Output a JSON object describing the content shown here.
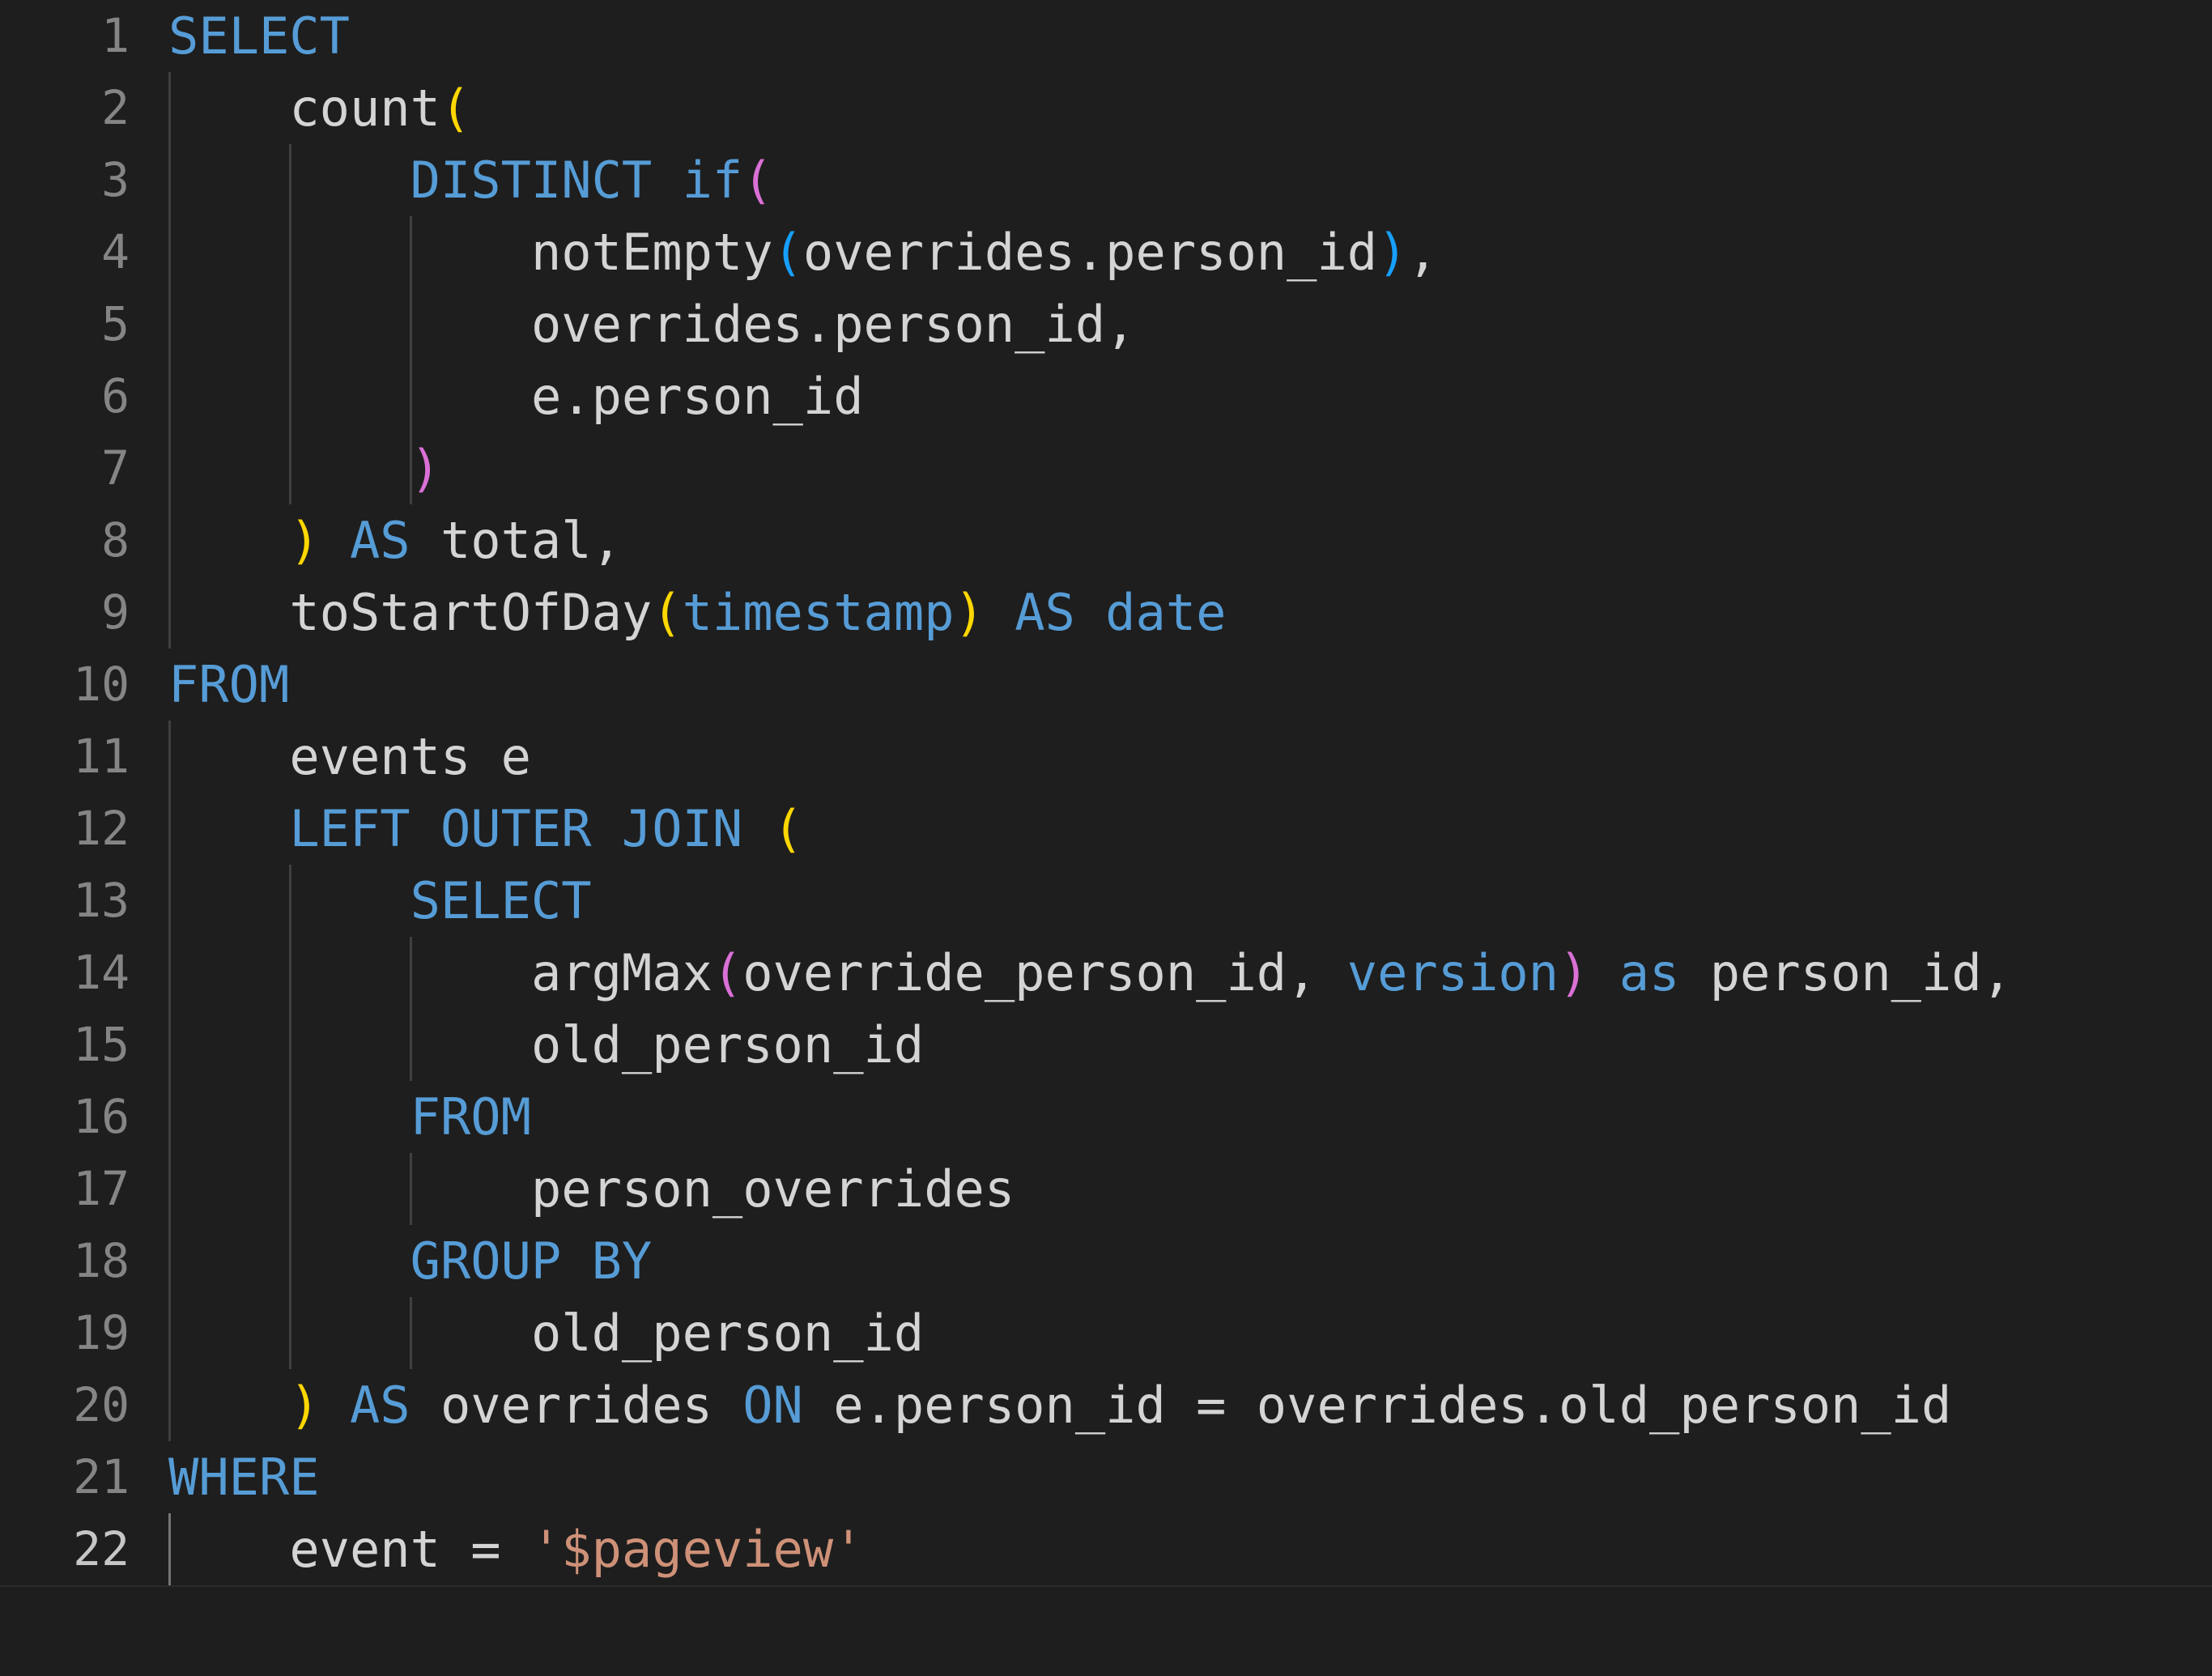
{
  "editor": {
    "language": "sql",
    "theme": "dark-plus",
    "background": "#1e1e1e",
    "active_line": 22,
    "colors": {
      "background": "#1e1e1e",
      "foreground": "#d4d4d4",
      "line_number": "#858585",
      "line_number_active": "#c6c6c6",
      "keyword": "#569cd6",
      "string": "#ce9178",
      "bracket_depth_1": "#ffd700",
      "bracket_depth_2": "#da70d6",
      "bracket_depth_3": "#179fff",
      "indent_guide": "#404040",
      "indent_guide_active": "#767676"
    },
    "lines": [
      {
        "number": "1",
        "indent": 0,
        "guides": [],
        "tokens": [
          {
            "t": "SELECT",
            "c": "kw"
          }
        ]
      },
      {
        "number": "2",
        "indent": 1,
        "guides": [
          0
        ],
        "tokens": [
          {
            "t": "    ",
            "c": "plain"
          },
          {
            "t": "count",
            "c": "plain"
          },
          {
            "t": "(",
            "c": "b1"
          }
        ]
      },
      {
        "number": "3",
        "indent": 2,
        "guides": [
          0,
          1
        ],
        "tokens": [
          {
            "t": "        ",
            "c": "plain"
          },
          {
            "t": "DISTINCT",
            "c": "kw"
          },
          {
            "t": " ",
            "c": "plain"
          },
          {
            "t": "if",
            "c": "kw"
          },
          {
            "t": "(",
            "c": "b2"
          }
        ]
      },
      {
        "number": "4",
        "indent": 3,
        "guides": [
          0,
          1,
          2
        ],
        "tokens": [
          {
            "t": "            ",
            "c": "plain"
          },
          {
            "t": "notEmpty",
            "c": "plain"
          },
          {
            "t": "(",
            "c": "b3"
          },
          {
            "t": "overrides.person_id",
            "c": "plain"
          },
          {
            "t": ")",
            "c": "b3"
          },
          {
            "t": ",",
            "c": "plain"
          }
        ]
      },
      {
        "number": "5",
        "indent": 3,
        "guides": [
          0,
          1,
          2
        ],
        "tokens": [
          {
            "t": "            ",
            "c": "plain"
          },
          {
            "t": "overrides.person_id,",
            "c": "plain"
          }
        ]
      },
      {
        "number": "6",
        "indent": 3,
        "guides": [
          0,
          1,
          2
        ],
        "tokens": [
          {
            "t": "            ",
            "c": "plain"
          },
          {
            "t": "e.person_id",
            "c": "plain"
          }
        ]
      },
      {
        "number": "7",
        "indent": 2,
        "guides": [
          0,
          1,
          2
        ],
        "tokens": [
          {
            "t": "        ",
            "c": "plain"
          },
          {
            "t": ")",
            "c": "b2"
          }
        ]
      },
      {
        "number": "8",
        "indent": 1,
        "guides": [
          0
        ],
        "tokens": [
          {
            "t": "    ",
            "c": "plain"
          },
          {
            "t": ")",
            "c": "b1"
          },
          {
            "t": " ",
            "c": "plain"
          },
          {
            "t": "AS",
            "c": "kw"
          },
          {
            "t": " ",
            "c": "plain"
          },
          {
            "t": "total,",
            "c": "plain"
          }
        ]
      },
      {
        "number": "9",
        "indent": 1,
        "guides": [
          0
        ],
        "tokens": [
          {
            "t": "    ",
            "c": "plain"
          },
          {
            "t": "toStartOfDay",
            "c": "plain"
          },
          {
            "t": "(",
            "c": "b1"
          },
          {
            "t": "timestamp",
            "c": "kw"
          },
          {
            "t": ")",
            "c": "b1"
          },
          {
            "t": " ",
            "c": "plain"
          },
          {
            "t": "AS",
            "c": "kw"
          },
          {
            "t": " ",
            "c": "plain"
          },
          {
            "t": "date",
            "c": "kw"
          }
        ]
      },
      {
        "number": "10",
        "indent": 0,
        "guides": [],
        "tokens": [
          {
            "t": "FROM",
            "c": "kw"
          }
        ]
      },
      {
        "number": "11",
        "indent": 1,
        "guides": [
          0
        ],
        "tokens": [
          {
            "t": "    ",
            "c": "plain"
          },
          {
            "t": "events e",
            "c": "plain"
          }
        ]
      },
      {
        "number": "12",
        "indent": 1,
        "guides": [
          0
        ],
        "tokens": [
          {
            "t": "    ",
            "c": "plain"
          },
          {
            "t": "LEFT OUTER JOIN",
            "c": "kw"
          },
          {
            "t": " ",
            "c": "plain"
          },
          {
            "t": "(",
            "c": "b1"
          }
        ]
      },
      {
        "number": "13",
        "indent": 2,
        "guides": [
          0,
          1
        ],
        "tokens": [
          {
            "t": "        ",
            "c": "plain"
          },
          {
            "t": "SELECT",
            "c": "kw"
          }
        ]
      },
      {
        "number": "14",
        "indent": 3,
        "guides": [
          0,
          1,
          2
        ],
        "tokens": [
          {
            "t": "            ",
            "c": "plain"
          },
          {
            "t": "argMax",
            "c": "plain"
          },
          {
            "t": "(",
            "c": "b2"
          },
          {
            "t": "override_person_id, ",
            "c": "plain"
          },
          {
            "t": "version",
            "c": "kw"
          },
          {
            "t": ")",
            "c": "b2"
          },
          {
            "t": " ",
            "c": "plain"
          },
          {
            "t": "as",
            "c": "kw"
          },
          {
            "t": " ",
            "c": "plain"
          },
          {
            "t": "person_id,",
            "c": "plain"
          }
        ]
      },
      {
        "number": "15",
        "indent": 3,
        "guides": [
          0,
          1,
          2
        ],
        "tokens": [
          {
            "t": "            ",
            "c": "plain"
          },
          {
            "t": "old_person_id",
            "c": "plain"
          }
        ]
      },
      {
        "number": "16",
        "indent": 2,
        "guides": [
          0,
          1
        ],
        "tokens": [
          {
            "t": "        ",
            "c": "plain"
          },
          {
            "t": "FROM",
            "c": "kw"
          }
        ]
      },
      {
        "number": "17",
        "indent": 3,
        "guides": [
          0,
          1,
          2
        ],
        "tokens": [
          {
            "t": "            ",
            "c": "plain"
          },
          {
            "t": "person_overrides",
            "c": "plain"
          }
        ]
      },
      {
        "number": "18",
        "indent": 2,
        "guides": [
          0,
          1
        ],
        "tokens": [
          {
            "t": "        ",
            "c": "plain"
          },
          {
            "t": "GROUP BY",
            "c": "kw"
          }
        ]
      },
      {
        "number": "19",
        "indent": 3,
        "guides": [
          0,
          1,
          2
        ],
        "tokens": [
          {
            "t": "            ",
            "c": "plain"
          },
          {
            "t": "old_person_id",
            "c": "plain"
          }
        ]
      },
      {
        "number": "20",
        "indent": 1,
        "guides": [
          0
        ],
        "tokens": [
          {
            "t": "    ",
            "c": "plain"
          },
          {
            "t": ")",
            "c": "b1"
          },
          {
            "t": " ",
            "c": "plain"
          },
          {
            "t": "AS",
            "c": "kw"
          },
          {
            "t": " ",
            "c": "plain"
          },
          {
            "t": "overrides",
            "c": "plain"
          },
          {
            "t": " ",
            "c": "plain"
          },
          {
            "t": "ON",
            "c": "kw"
          },
          {
            "t": " ",
            "c": "plain"
          },
          {
            "t": "e.person_id = overrides.old_person_id",
            "c": "plain"
          }
        ]
      },
      {
        "number": "21",
        "indent": 0,
        "guides": [],
        "tokens": [
          {
            "t": "WHERE",
            "c": "kw"
          }
        ]
      },
      {
        "number": "22",
        "indent": 1,
        "guides": [
          0
        ],
        "active_guide": 0,
        "active": true,
        "tokens": [
          {
            "t": "    ",
            "c": "plain"
          },
          {
            "t": "event = ",
            "c": "plain"
          },
          {
            "t": "'$pageview'",
            "c": "str"
          }
        ]
      }
    ]
  }
}
